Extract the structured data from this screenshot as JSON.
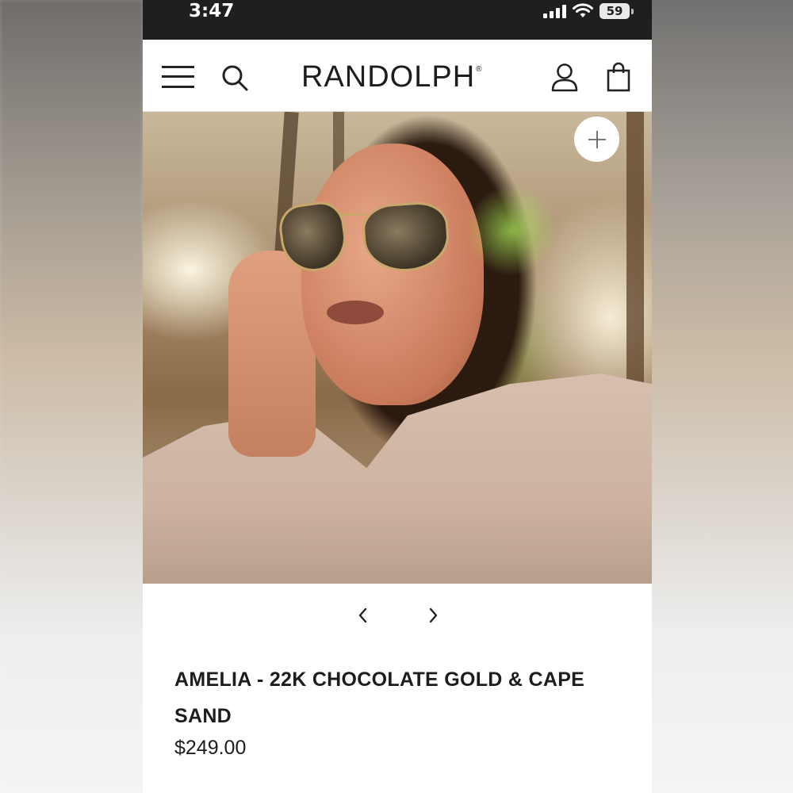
{
  "status_bar": {
    "time": "3:47",
    "battery": "59"
  },
  "header": {
    "brand": "RANDOLPH",
    "registered_mark": "®"
  },
  "product": {
    "title": "AMELIA - 22K CHOCOLATE GOLD & CAPE SAND",
    "price": "$249.00"
  },
  "icons": {
    "menu": "hamburger-menu-icon",
    "search": "search-icon",
    "account": "user-icon",
    "bag": "shopping-bag-icon",
    "zoom": "plus-icon",
    "prev": "chevron-left-icon",
    "next": "chevron-right-icon"
  },
  "colors": {
    "status_bar_bg": "#1f1f1f",
    "text": "#1d1d1d",
    "rating_star": "#f1c40f"
  }
}
